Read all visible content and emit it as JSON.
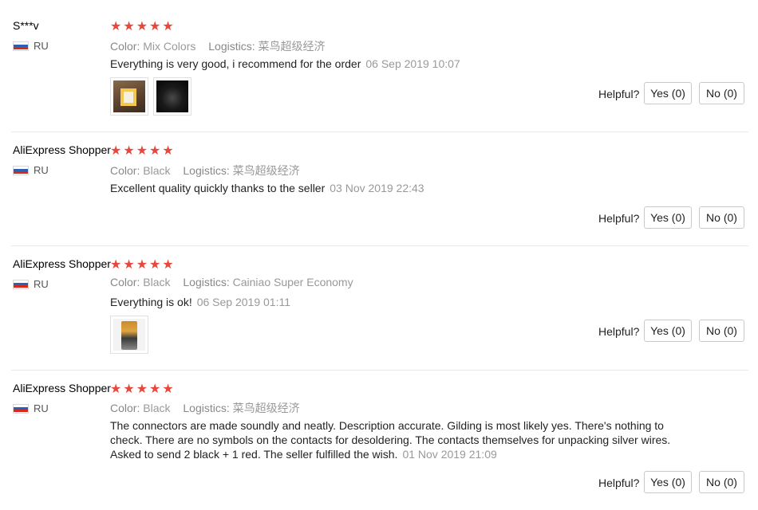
{
  "ui": {
    "color_key": "Color:",
    "logistics_key": "Logistics:",
    "helpful_label": "Helpful?",
    "star_glyph": "★",
    "star_color": "#e8473b"
  },
  "reviews": [
    {
      "user": "S***v",
      "country": "RU",
      "rating": 5,
      "color": "Mix Colors",
      "logistics": "菜鸟超级经济",
      "text": "Everything is very good, i recommend for the order",
      "date": "06 Sep 2019 10:07",
      "photos": [
        "product-photo-package",
        "product-photo-dark-item"
      ],
      "yes": "Yes (0)",
      "no": "No (0)"
    },
    {
      "user": "AliExpress Shopper",
      "country": "RU",
      "rating": 5,
      "color": "Black",
      "logistics": "菜鸟超级经济",
      "text": "Excellent quality quickly thanks to the seller",
      "date": "03 Nov 2019 22:43",
      "photos": [],
      "yes": "Yes (0)",
      "no": "No (0)"
    },
    {
      "user": "AliExpress Shopper",
      "country": "RU",
      "rating": 5,
      "color": "Black",
      "logistics": "Cainiao Super Economy",
      "text": "Everything is ok!",
      "date": "06 Sep 2019 01:11",
      "photos": [
        "product-photo-bag"
      ],
      "yes": "Yes (0)",
      "no": "No (0)"
    },
    {
      "user": "AliExpress Shopper",
      "country": "RU",
      "rating": 5,
      "color": "Black",
      "logistics": "菜鸟超级经济",
      "text": "The connectors are made soundly and neatly. Description accurate. Gilding is most likely yes. There's nothing to check. There are no symbols on the contacts for desoldering. The contacts themselves for unpacking silver wires. Asked to send 2 black + 1 red. The seller fulfilled the wish.",
      "date": "01 Nov 2019 21:09",
      "photos": [],
      "yes": "Yes (0)",
      "no": "No (0)"
    }
  ]
}
